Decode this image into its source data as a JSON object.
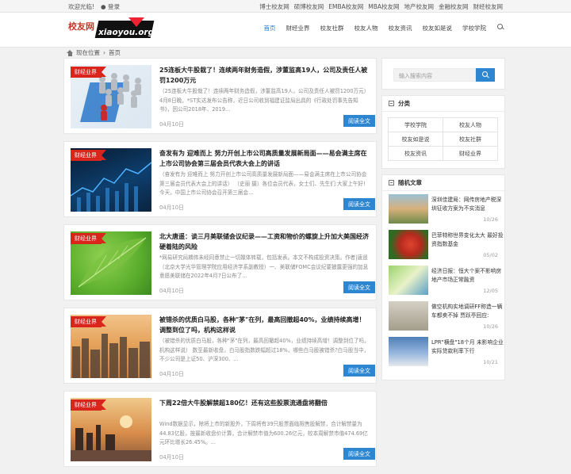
{
  "topbar": {
    "welcome": "欢迎光临!",
    "login": "登录",
    "links": [
      "博士校友网",
      "硕博校友网",
      "EMBA校友网",
      "MBA校友网",
      "地产校友网",
      "金融校友网",
      "财经校友网"
    ]
  },
  "header": {
    "logo_cn": "校友网",
    "logo_en": "xiaoyou.org",
    "nav": [
      "首页",
      "财经业界",
      "校友社群",
      "校友人物",
      "校友资讯",
      "校友如是说",
      "学校学院"
    ],
    "active_nav": "首页",
    "search_icon": "search-icon"
  },
  "breadcrumb": {
    "icon": "home-icon",
    "here": "现在位置",
    "sep": "›",
    "current": "首页"
  },
  "articles": [
    {
      "category": "财经业界",
      "title": "25连板大牛股栽了！连续两年财务造假，涉董监高19人，公司及责任人被罚1200万元",
      "excerpt": "（25连板大牛股栽了！连续两年财务造假，涉董监高19人，公司及责任人被罚1200万元）  4月8日晚，*ST实达发布公告称，近日公司收到福建证监局出具的《行政处罚事先告知书》，因公司2018年、2019...",
      "date": "04月10日",
      "more": "阅读全文"
    },
    {
      "category": "财经业界",
      "title": "奋发有为 迎难而上 努力开创上市公司高质量发展新局面——易会满主席在上市公司协会第三届会员代表大会上的讲话",
      "excerpt": "（奋发有为 迎难而上 努力开创上市公司高质量发展新局面——易会满主席在上市公司协会第三届会员代表大会上的讲话）  （史丽 摄）各位会员代表，女士们、先生们:大家上午好!今天，中国上市公司协会召开第三届会...",
      "date": "04月10日",
      "more": "阅读全文"
    },
    {
      "category": "财经业界",
      "title": "北大唐遥：谈三月美联储会议纪录——工资和物价的螺旋上升加大美国经济硬着陆的风险",
      "excerpt": "*网易研究局耦伟未经同意禁止一切媒体转载，包括发表。本文不构成投资决策。作者|唐遥（北京大学光华管理学院应用经济学系副教授）一、美联储FOMC会议纪要披露更强的加息意愿美联储在2022年4月7日公布了...",
      "date": "04月10日",
      "more": "阅读全文"
    },
    {
      "category": "财经业界",
      "title": "被错杀的优质白马股，各种\"茅\"在列，最高回撤超40%，业绩持续高增！调整到位了吗，机构这样说",
      "excerpt": "（被错杀的优质白马股，各种\"茅\"在列，最高回撤超40%，业绩持续高增！调整到位了吗，机构这样说）  数至最新收盘，白马股指数跌幅超过18%，哪些白马股被错杀?白马股当中，不少公司是上证50、沪深300、...",
      "date": "04月10日",
      "more": "阅读全文"
    },
    {
      "category": "财经业界",
      "title": "下周22倍大牛股解禁超180亿！还有这些股票流通盘将翻倍",
      "excerpt": "Wind数据显示，除将上市的新股外，下周将有39只股票面临限售股解禁，合计解禁量为44.83亿股，按最新收盘价计算，合计解禁市值为600.26亿元，较本周解禁市值474.69亿元环比增长26.45%。...",
      "date": "04月10日",
      "more": "阅读全文"
    }
  ],
  "sidebar": {
    "search_placeholder": "输入搜索内容",
    "categories_title": "分类",
    "categories": [
      "学校学院",
      "校友人物",
      "校友如是说",
      "校友社群",
      "校友资讯",
      "财经业界"
    ],
    "random_title": "随机文章",
    "random": [
      {
        "title": "深圳佳建局：网传房地产税深圳征收方案为不实消息",
        "date": "10/26"
      },
      {
        "title": "巴菲特称世界变化太大 最好投资指数基金",
        "date": "05/02"
      },
      {
        "title": "经济日报：恒大个案不影响房地产市场正常融资",
        "date": "12/05"
      },
      {
        "title": "做空机构实地调研FF称造一辆车都卖不掉 贾跃亭回应:",
        "date": "10/26"
      },
      {
        "title": "LPR\"横盘\"18个月 未影响企业实际贷款利率下行",
        "date": "10/21"
      }
    ]
  }
}
